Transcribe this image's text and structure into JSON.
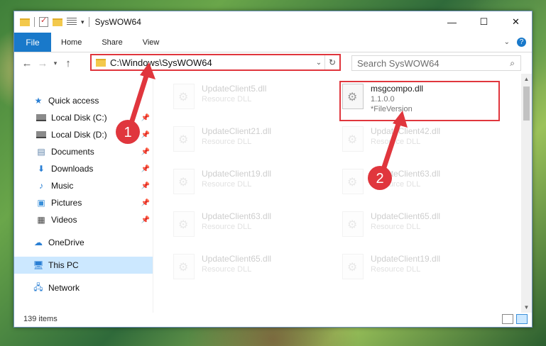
{
  "window": {
    "title": "SysWOW64",
    "controls": {
      "minimize": "—",
      "maximize": "☐",
      "close": "✕"
    }
  },
  "ribbon": {
    "file_tab": "File",
    "tabs": [
      "Home",
      "Share",
      "View"
    ],
    "help": "?"
  },
  "address": {
    "path": "C:\\Windows\\SysWOW64",
    "search_placeholder": "Search SysWOW64"
  },
  "navigation": {
    "items": [
      {
        "label": "Quick access",
        "icon": "star-icon"
      },
      {
        "label": "Local Disk (C:)",
        "icon": "drive-icon",
        "pinned": true
      },
      {
        "label": "Local Disk (D:)",
        "icon": "drive-icon",
        "pinned": true
      },
      {
        "label": "Documents",
        "icon": "documents-icon",
        "pinned": true
      },
      {
        "label": "Downloads",
        "icon": "downloads-icon",
        "pinned": true
      },
      {
        "label": "Music",
        "icon": "music-icon",
        "pinned": true
      },
      {
        "label": "Pictures",
        "icon": "pictures-icon",
        "pinned": true
      },
      {
        "label": "Videos",
        "icon": "videos-icon",
        "pinned": true
      },
      {
        "label": "OneDrive",
        "icon": "cloud-icon"
      },
      {
        "label": "This PC",
        "icon": "computer-icon",
        "selected": true
      },
      {
        "label": "Network",
        "icon": "network-icon"
      }
    ]
  },
  "files": [
    {
      "name": "UpdateClient5.dll",
      "sub": "Resource DLL",
      "faded": true
    },
    {
      "name": "msgcompo.dll",
      "sub": "1.1.0.0",
      "sub2": "*FileVersion",
      "highlighted": true
    },
    {
      "name": "UpdateClient21.dll",
      "sub": "Resource DLL",
      "faded": true
    },
    {
      "name": "UpdateClient42.dll",
      "sub": "Resource DLL",
      "faded": true
    },
    {
      "name": "UpdateClient19.dll",
      "sub": "Resource DLL",
      "faded": true
    },
    {
      "name": "UpdateClient63.dll",
      "sub": "Resource DLL",
      "faded": true
    },
    {
      "name": "UpdateClient63.dll",
      "sub": "Resource DLL",
      "faded": true
    },
    {
      "name": "UpdateClient65.dll",
      "sub": "Resource DLL",
      "faded": true
    },
    {
      "name": "UpdateClient65.dll",
      "sub": "Resource DLL",
      "faded": true
    },
    {
      "name": "UpdateClient19.dll",
      "sub": "Resource DLL",
      "faded": true
    }
  ],
  "status": {
    "count": "139 items"
  },
  "annotations": [
    {
      "number": "1",
      "color": "#e0363d"
    },
    {
      "number": "2",
      "color": "#e0363d"
    }
  ]
}
